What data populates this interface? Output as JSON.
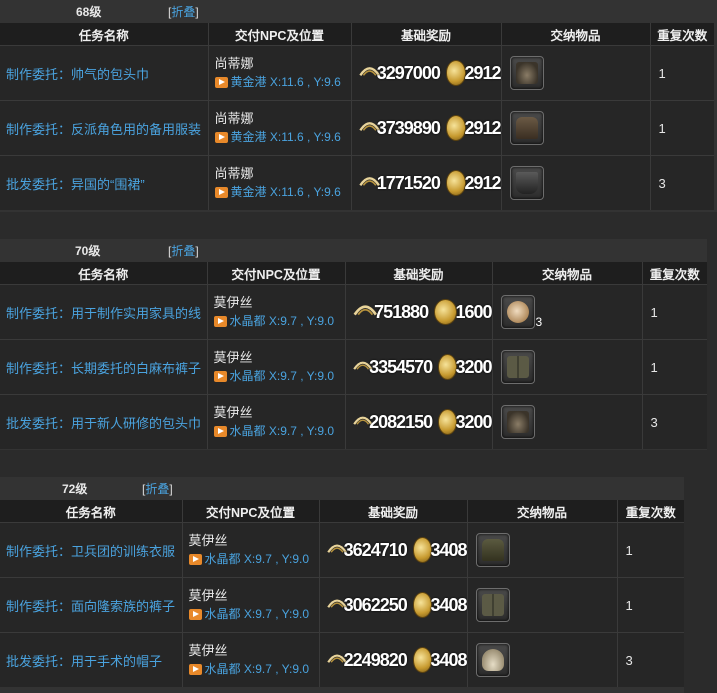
{
  "fold_label": "折叠",
  "headers": {
    "name": "任务名称",
    "npc": "交付NPC及位置",
    "reward": "基础奖励",
    "item": "交纳物品",
    "repeat": "重复次数"
  },
  "sections": [
    {
      "level": "68级",
      "rows": [
        {
          "name": "制作委托：帅气的包头巾",
          "npc": "尚蒂娜",
          "place": "黄金港",
          "coords": "X:11.6 , Y:9.6",
          "exp": "3297000",
          "gil": "2912",
          "item_icon": "turban-icon",
          "qty": "",
          "repeat": "1"
        },
        {
          "name": "制作委托：反派角色用的备用服装",
          "npc": "尚蒂娜",
          "place": "黄金港",
          "coords": "X:11.6 , Y:9.6",
          "exp": "3739890",
          "gil": "2912",
          "item_icon": "costume-icon",
          "qty": "",
          "repeat": "1"
        },
        {
          "name": "批发委托：异国的“围裙”",
          "npc": "尚蒂娜",
          "place": "黄金港",
          "coords": "X:11.6 , Y:9.6",
          "exp": "1771520",
          "gil": "2912",
          "item_icon": "apron-icon",
          "qty": "",
          "repeat": "3"
        }
      ]
    },
    {
      "level": "70级",
      "rows": [
        {
          "name": "制作委托：用于制作实用家具的线",
          "npc": "莫伊丝",
          "place": "水晶都",
          "coords": "X:9.7 , Y:9.0",
          "exp": "751880",
          "gil": "1600",
          "item_icon": "thread-icon",
          "qty": "3",
          "repeat": "1"
        },
        {
          "name": "制作委托：长期委托的白麻布裤子",
          "npc": "莫伊丝",
          "place": "水晶都",
          "coords": "X:9.7 , Y:9.0",
          "exp": "3354570",
          "gil": "3200",
          "item_icon": "trousers-icon",
          "qty": "",
          "repeat": "1"
        },
        {
          "name": "批发委托：用于新人研修的包头巾",
          "npc": "莫伊丝",
          "place": "水晶都",
          "coords": "X:9.7 , Y:9.0",
          "exp": "2082150",
          "gil": "3200",
          "item_icon": "turban-icon",
          "qty": "",
          "repeat": "3"
        }
      ]
    },
    {
      "level": "72级",
      "rows": [
        {
          "name": "制作委托：卫兵团的训练衣服",
          "npc": "莫伊丝",
          "place": "水晶都",
          "coords": "X:9.7 , Y:9.0",
          "exp": "3624710",
          "gil": "3408",
          "item_icon": "coat-icon",
          "qty": "",
          "repeat": "1"
        },
        {
          "name": "制作委托：面向隆索族的裤子",
          "npc": "莫伊丝",
          "place": "水晶都",
          "coords": "X:9.7 , Y:9.0",
          "exp": "3062250",
          "gil": "3408",
          "item_icon": "trousers-icon",
          "qty": "",
          "repeat": "1"
        },
        {
          "name": "批发委托：用于手术的帽子",
          "npc": "莫伊丝",
          "place": "水晶都",
          "coords": "X:9.7 , Y:9.0",
          "exp": "2249820",
          "gil": "3408",
          "item_icon": "cap-icon",
          "qty": "",
          "repeat": "3"
        }
      ]
    }
  ]
}
